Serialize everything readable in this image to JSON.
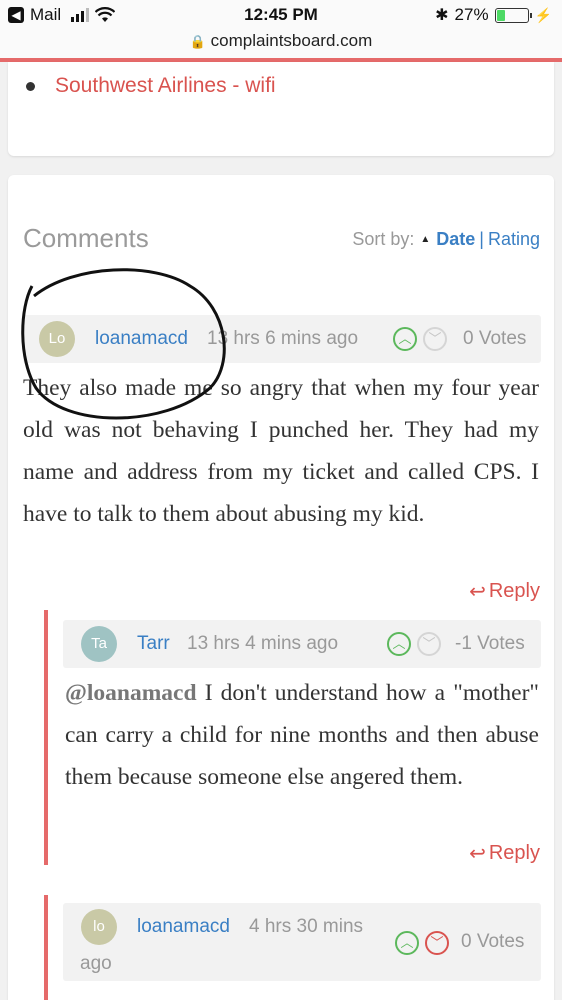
{
  "status_bar": {
    "back_app": "Mail",
    "time": "12:45 PM",
    "battery": "27%",
    "battery_level": 0.27
  },
  "browser": {
    "url": "complaintsboard.com"
  },
  "related": {
    "link_text": "Southwest Airlines - wifi"
  },
  "comments": {
    "title": "Comments",
    "sort_label": "Sort by:",
    "sort_date": "Date",
    "sort_sep": "|",
    "sort_rating": "Rating",
    "reply_label": "Reply",
    "items": [
      {
        "avatar": "Lo",
        "avatar_color": "#c9c9a6",
        "author": "loanamacd",
        "time": "13 hrs 6 mins ago",
        "votes": "0 Votes",
        "text": "They also made me so angry that when my four year old was not behaving I punched her. They had my name and address from my ticket and called CPS. I have to talk to them about abusing my kid."
      },
      {
        "avatar": "Ta",
        "avatar_color": "#9fc3c3",
        "author": "Tarr",
        "time": "13 hrs 4 mins ago",
        "votes": "-1 Votes",
        "mention": "@loanamacd",
        "text": " I don't understand how a \"mother\" can carry a child for nine months and then abuse them because someone else angered them."
      },
      {
        "avatar": "lo",
        "avatar_color": "#c9c9a6",
        "author": "loanamacd",
        "time": "4 hrs 30 mins",
        "time_cont": "ago",
        "votes": "0 Votes"
      }
    ]
  },
  "colors": {
    "accent_red": "#d9534f",
    "link_blue": "#3a7fc4",
    "thread_bar": "#e56a6a"
  }
}
